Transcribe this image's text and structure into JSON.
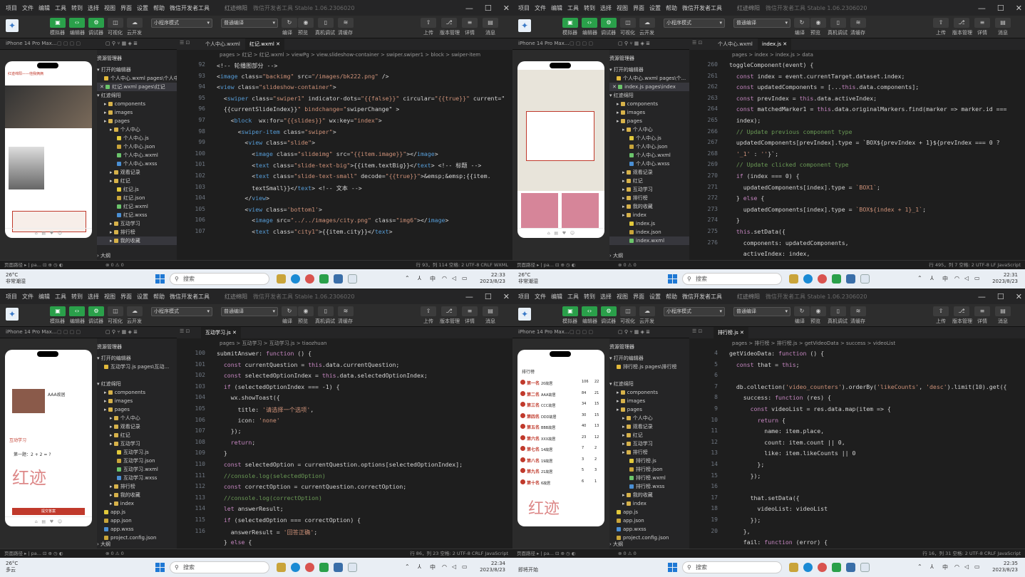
{
  "menu": [
    "项目",
    "文件",
    "编辑",
    "工具",
    "转到",
    "选择",
    "视图",
    "界面",
    "设置",
    "帮助",
    "微信开发者工具"
  ],
  "win_title": "红迹绵阳",
  "win_sub": "微信开发者工具 Stable 1.06.2306020",
  "toolbar": {
    "b1": "模拟器",
    "b2": "编辑器",
    "b3": "调试器",
    "b4": "可视化",
    "b5": "云开发",
    "mode": "小程序模式",
    "compile": "普通编译",
    "r1": "编译",
    "r2": "预览",
    "r3": "真机调试",
    "r4": "清缓存",
    "r5": "上传",
    "r6": "版本管理",
    "r7": "详情",
    "r8": "消息"
  },
  "device": "iPhone 14 Pro Max...",
  "resource": "资源管理器",
  "explorer_header": "打开的编辑器",
  "project_root": "红迹绵阳",
  "outline": "大纲",
  "quad": [
    {
      "tab1": "个人中心.wxml",
      "tab2": "红记.wxml",
      "crumb": "pages > 红记 > 红记.wxml > viewPg > view.slideshow-container > swiper.swiper1 > block > swiper-item",
      "open1": "个人中心.wxml pages\\个人中心",
      "open2": "红记.wxml pages\\红记",
      "files": [
        "components",
        "images",
        "pages",
        "个人中心",
        "个人中心.js",
        "个人中心.json",
        "个人中心.wxml",
        "个人中心.wxss",
        "观看记录",
        "红记",
        "红记.js",
        "红记.json",
        "红记.wxml",
        "红记.wxss",
        "互动学习",
        "排行榜",
        "我的收藏"
      ],
      "lines": [
        "92",
        "93",
        "94",
        "95",
        "96",
        "97",
        "98",
        "99",
        "100",
        "101",
        "102",
        "103",
        "104",
        "105",
        "106",
        "107"
      ],
      "code": [
        "<!-- 轮播图部分 -->",
        "<image class=\"backimg\" src=\"/images/bk222.png\" />",
        "<view class=\"slideshow-container\">",
        "  <swiper class=\"swiper1\" indicator-dots=\"{{false}}\" circular=\"{{true}}\" current=\"",
        "  {{currentSlideIndex}}\" bindchange=\"swiperChange\" >",
        "    <block  wx:for=\"{{slides}}\" wx:key=\"index\">",
        "      <swiper-item class=\"swiper\">",
        "        <view class=\"slide\">",
        "          <image class=\"slideimg\" src=\"{{item.image}}\"></image>",
        "          <text class=\"slide-text-big\">{{item.textBig}}</text> <!-- 标题 -->",
        "          <text class=\"slide-text-small\" decode=\"{{true}}\">&emsp;&emsp;{{item.",
        "          textSmall}}</text> <!-- 文本 -->",
        "        </view>",
        "        <view class='bottom1'>",
        "          <image src=\"../../images/city.png\" class=\"img6\"></image>",
        "          <text class=\"city1\">{{item.city}}</text>"
      ],
      "status": "行 93，列 114   空格: 2   UTF-8   CRLF   WXML",
      "time": "22:33",
      "date": "2023/8/23",
      "weather_t": "26°C",
      "weather_d": "非常潮湿"
    },
    {
      "tab1": "个人中心.wxml",
      "tab2": "index.js",
      "crumb": "pages > index > index.js > data",
      "open1": "个人中心.wxml pages\\个...",
      "open2": "index.js pages\\index",
      "files": [
        "components",
        "images",
        "pages",
        "个人中心",
        "个人中心.js",
        "个人中心.json",
        "个人中心.wxml",
        "个人中心.wxss",
        "观看记录",
        "红记",
        "互动学习",
        "排行榜",
        "我的收藏",
        "index",
        "index.js",
        "index.json",
        "index.wxml"
      ],
      "lines": [
        "260",
        "261",
        "262",
        "263",
        "264",
        "265",
        "266",
        "267",
        "268",
        "269",
        "270",
        "271",
        "272",
        "273",
        "274",
        "275",
        "276"
      ],
      "code": [
        "toggleComponent(event) {",
        "  const index = event.currentTarget.dataset.index;",
        "  const updatedComponents = [...this.data.components];",
        "  const prevIndex = this.data.activeIndex;",
        "  const matchedMarker1 = this.data.originalMarkers.find(marker => marker.id ===",
        "  index);",
        "  // Update previous component type",
        "  updatedComponents[prevIndex].type = `BOX${prevIndex + 1}${prevIndex === 0 ?",
        "  '_1' : ''}`;",
        "  // Update clicked component type",
        "  if (index === 0) {",
        "    updatedComponents[index].type = `BOX1`;",
        "  } else {",
        "    updatedComponents[index].type = `BOX${index + 1}_1`;",
        "  }",
        "  this.setData({",
        "    components: updatedComponents,",
        "    activeIndex: index,"
      ],
      "status": "行 495，列 7   空格: 2   UTF-8   LF   JavaScript",
      "time": "22:31",
      "date": "2023/8/23",
      "weather_t": "26°C",
      "weather_d": "非常潮湿"
    },
    {
      "tab1": "互动学习.js",
      "tab2": "",
      "crumb": "pages > 互动学习 > 互动学习.js > tiaozhuan",
      "open1": "互动学习.js pages\\互动...",
      "open2": "",
      "files": [
        "components",
        "images",
        "pages",
        "个人中心",
        "观看记录",
        "红记",
        "互动学习",
        "互动学习.js",
        "互动学习.json",
        "互动学习.wxml",
        "互动学习.wxss",
        "排行榜",
        "我的收藏",
        "index",
        "app.js",
        "app.json",
        "app.wxss",
        "project.config.json"
      ],
      "lines": [
        "100",
        "101",
        "102",
        "103",
        "104",
        "105",
        "106",
        "107",
        "108",
        "109",
        "110",
        "111",
        "112",
        "113",
        "114",
        "115",
        "116"
      ],
      "code": [
        "submitAnswer: function () {",
        "  const currentQuestion = this.data.currentQuestion;",
        "  const selectedOptionIndex = this.data.selectedOptionIndex;",
        "  if (selectedOptionIndex === -1) {",
        "    wx.showToast({",
        "      title: '请选择一个选项',",
        "      icon: 'none'",
        "    });",
        "    return;",
        "  }",
        "  const selectedOption = currentQuestion.options[selectedOptionIndex];",
        "  //console.log(selectedOption)",
        "  const correctOption = currentQuestion.correctOption;",
        "  //console.log(correctOption)",
        "  let answerResult;",
        "  if (selectedOption === correctOption) {",
        "    answerResult = '回答正确';",
        "  } else {"
      ],
      "status": "行 86，列 23   空格: 2   UTF-8   CRLF   JavaScript",
      "time": "22:34",
      "date": "2023/8/23",
      "weather_t": "26°C",
      "weather_d": "多云"
    },
    {
      "tab1": "排行榜.js",
      "tab2": "",
      "crumb": "pages > 排行榜 > 排行榜.js > getVideoData > success > videoList",
      "open1": "排行榜.js pages\\排行榜",
      "open2": "",
      "files": [
        "components",
        "images",
        "pages",
        "个人中心",
        "观看记录",
        "红记",
        "互动学习",
        "排行榜",
        "排行榜.js",
        "排行榜.json",
        "排行榜.wxml",
        "排行榜.wxss",
        "我的收藏",
        "index",
        "app.js",
        "app.json",
        "app.wxss",
        "project.config.json"
      ],
      "lines": [
        "4",
        "5",
        "6",
        "7",
        "8",
        "9",
        "10",
        "11",
        "12",
        "13",
        "14",
        "15",
        "16",
        "17",
        "18",
        "19",
        "20"
      ],
      "code": [
        "getVideoData: function () {",
        "  const that = this;",
        "",
        "  db.collection('video_counters').orderBy('likeCounts', 'desc').limit(10).get({",
        "    success: function (res) {",
        "      const videoList = res.data.map(item => {",
        "        return {",
        "          name: item.place,",
        "          count: item.count || 0,",
        "          like: item.likeCounts || 0",
        "        };",
        "      });",
        "",
        "      that.setData({",
        "        videoList: videoList",
        "      });",
        "    },",
        "    fail: function (error) {"
      ],
      "status": "行 16，列 31   空格: 2   UTF-8   CRLF   JavaScript",
      "time": "22:35",
      "date": "2023/8/23",
      "weather_t": "",
      "weather_d": "即将开始"
    }
  ],
  "taskbar_search": "搜索",
  "ime": "中",
  "rank": {
    "title": "排行榜",
    "rows": [
      {
        "r": "第一名",
        "n": "20故居",
        "c": "106",
        "l": "22"
      },
      {
        "r": "第二名",
        "n": "AAA故居",
        "c": "84",
        "l": "21"
      },
      {
        "r": "第三名",
        "n": "CCC故居",
        "c": "34",
        "l": "15"
      },
      {
        "r": "第四名",
        "n": "DDD故居",
        "c": "30",
        "l": "15"
      },
      {
        "r": "第五名",
        "n": "BBB故居",
        "c": "40",
        "l": "13"
      },
      {
        "r": "第六名",
        "n": "XXX故居",
        "c": "23",
        "l": "12"
      },
      {
        "r": "第七名",
        "n": "14故居",
        "c": "7",
        "l": "2"
      },
      {
        "r": "第八名",
        "n": "19故居",
        "c": "3",
        "l": "2"
      },
      {
        "r": "第九名",
        "n": "21故居",
        "c": "5",
        "l": "3"
      },
      {
        "r": "第十名",
        "n": "6故居",
        "c": "6",
        "l": "1"
      }
    ]
  },
  "quiz": {
    "q": "第一题：2 + 2 = ?",
    "btn": "提交答案",
    "sec": "互动学习",
    "place": "AAA故居"
  },
  "phone_header": "红迹绵阳——他我俩俩"
}
